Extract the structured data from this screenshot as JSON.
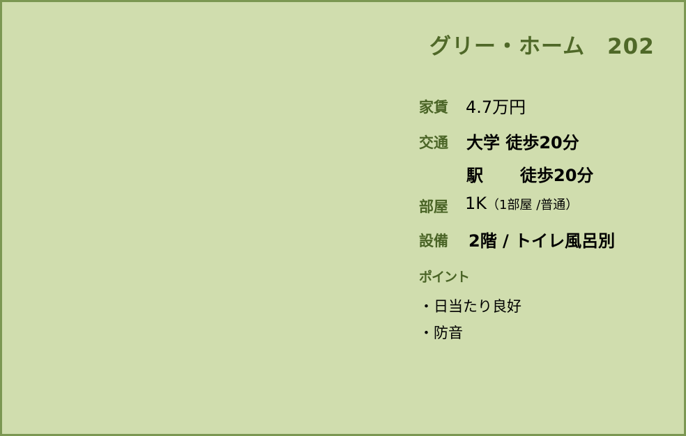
{
  "title": "グリー・ホーム　202",
  "rent": {
    "label": "家賃",
    "value": "4.7万円"
  },
  "transport": {
    "label": "交通",
    "line1": "大学 徒歩20分",
    "line2_place": "駅",
    "line2_time": "徒歩20分"
  },
  "room": {
    "label": "部屋",
    "main": "1K",
    "detail": "（1部屋 /普通）"
  },
  "facilities": {
    "label": "設備",
    "value": "2階 / トイレ風呂別"
  },
  "points": {
    "label": "ポイント",
    "items": [
      "・日当たり良好",
      "・防音"
    ]
  }
}
